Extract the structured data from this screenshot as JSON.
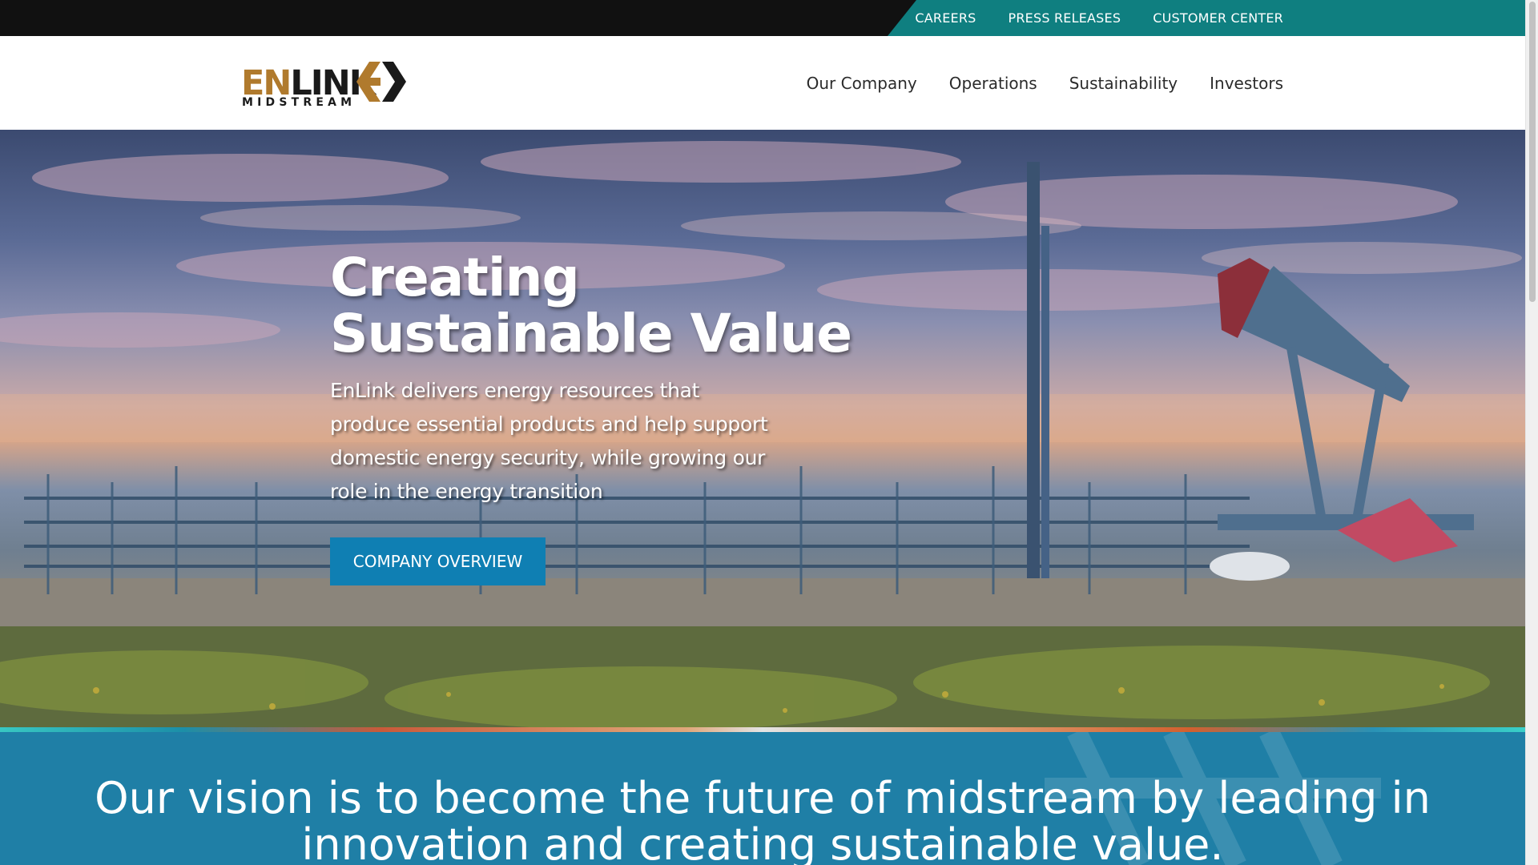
{
  "utility_nav": [
    "CAREERS",
    "PRESS RELEASES",
    "CUSTOMER CENTER"
  ],
  "logo": {
    "word_gold": "EN",
    "word_dark": "LINK",
    "subword": "MIDSTREAM",
    "icon": "enlink-arrow-logo-icon"
  },
  "main_nav": [
    "Our Company",
    "Operations",
    "Sustainability",
    "Investors"
  ],
  "hero": {
    "title": "Creating Sustainable Value",
    "description": "EnLink delivers energy resources that produce essential products and help support domestic energy security, while growing our role in the energy transition",
    "button_label": "COMPANY OVERVIEW"
  },
  "vision": {
    "text": "Our vision is to become the future of midstream by leading in innovation and creating sustainable value."
  },
  "colors": {
    "topbar": "#111111",
    "topbar_accent": "#0f7f80",
    "button": "#0f7fb3",
    "vision_bg": "#1f7fa6",
    "logo_gold": "#b07a2d"
  }
}
